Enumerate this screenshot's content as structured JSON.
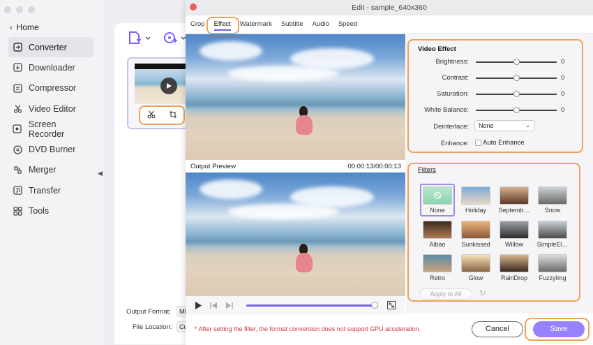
{
  "sidebar": {
    "home_label": "Home",
    "items": [
      {
        "label": "Converter",
        "icon": "converter-icon",
        "active": true
      },
      {
        "label": "Downloader",
        "icon": "downloader-icon"
      },
      {
        "label": "Compressor",
        "icon": "compressor-icon"
      },
      {
        "label": "Video Editor",
        "icon": "scissors-icon"
      },
      {
        "label": "Screen Recorder",
        "icon": "screen-record-icon"
      },
      {
        "label": "DVD Burner",
        "icon": "disc-icon"
      },
      {
        "label": "Merger",
        "icon": "merge-icon"
      },
      {
        "label": "Transfer",
        "icon": "transfer-icon"
      },
      {
        "label": "Tools",
        "icon": "grid-icon"
      }
    ]
  },
  "background": {
    "output_format_label": "Output Format:",
    "output_format_value": "MI",
    "file_location_label": "File Location:",
    "file_location_value": "Cc"
  },
  "dialog": {
    "title": "Edit - sample_640x360",
    "tabs": [
      "Crop",
      "Effect",
      "Watermark",
      "Subtitle",
      "Audio",
      "Speed"
    ],
    "active_tab": "Effect",
    "output_preview_label": "Output Preview",
    "timecode": "00:00:13/00:00:13",
    "progress_fraction": 1.0
  },
  "video_effect": {
    "title": "Video Effect",
    "sliders": [
      {
        "label": "Brightness:",
        "value": "0",
        "fraction": 0.5
      },
      {
        "label": "Contrast:",
        "value": "0",
        "fraction": 0.5
      },
      {
        "label": "Saturation:",
        "value": "0",
        "fraction": 0.5
      },
      {
        "label": "White Balance:",
        "value": "0",
        "fraction": 0.5
      }
    ],
    "deinterlace_label": "Deinterlace:",
    "deinterlace_value": "None",
    "enhance_label": "Enhance:",
    "auto_enhance_label": "Auto Enhance",
    "auto_enhance_checked": false
  },
  "filters": {
    "title": "Filters",
    "items": [
      {
        "name": "None",
        "selected": true
      },
      {
        "name": "Holiday"
      },
      {
        "name": "Septemb…"
      },
      {
        "name": "Snow"
      },
      {
        "name": "Aibao"
      },
      {
        "name": "Sunkissed"
      },
      {
        "name": "Willow"
      },
      {
        "name": "SimpleEl…"
      },
      {
        "name": "Retro"
      },
      {
        "name": "Glow"
      },
      {
        "name": "RainDrop"
      },
      {
        "name": "FuzzyImg"
      }
    ],
    "apply_all_label": "Apply to All"
  },
  "footer": {
    "warning": "* After setting the filter, the format conversion does not support GPU acceleration.",
    "cancel_label": "Cancel",
    "save_label": "Save"
  },
  "colors": {
    "accent": "#7b61ff",
    "save_button": "#9781ff",
    "highlight": "#f0a25a",
    "warning": "#d0363d"
  }
}
